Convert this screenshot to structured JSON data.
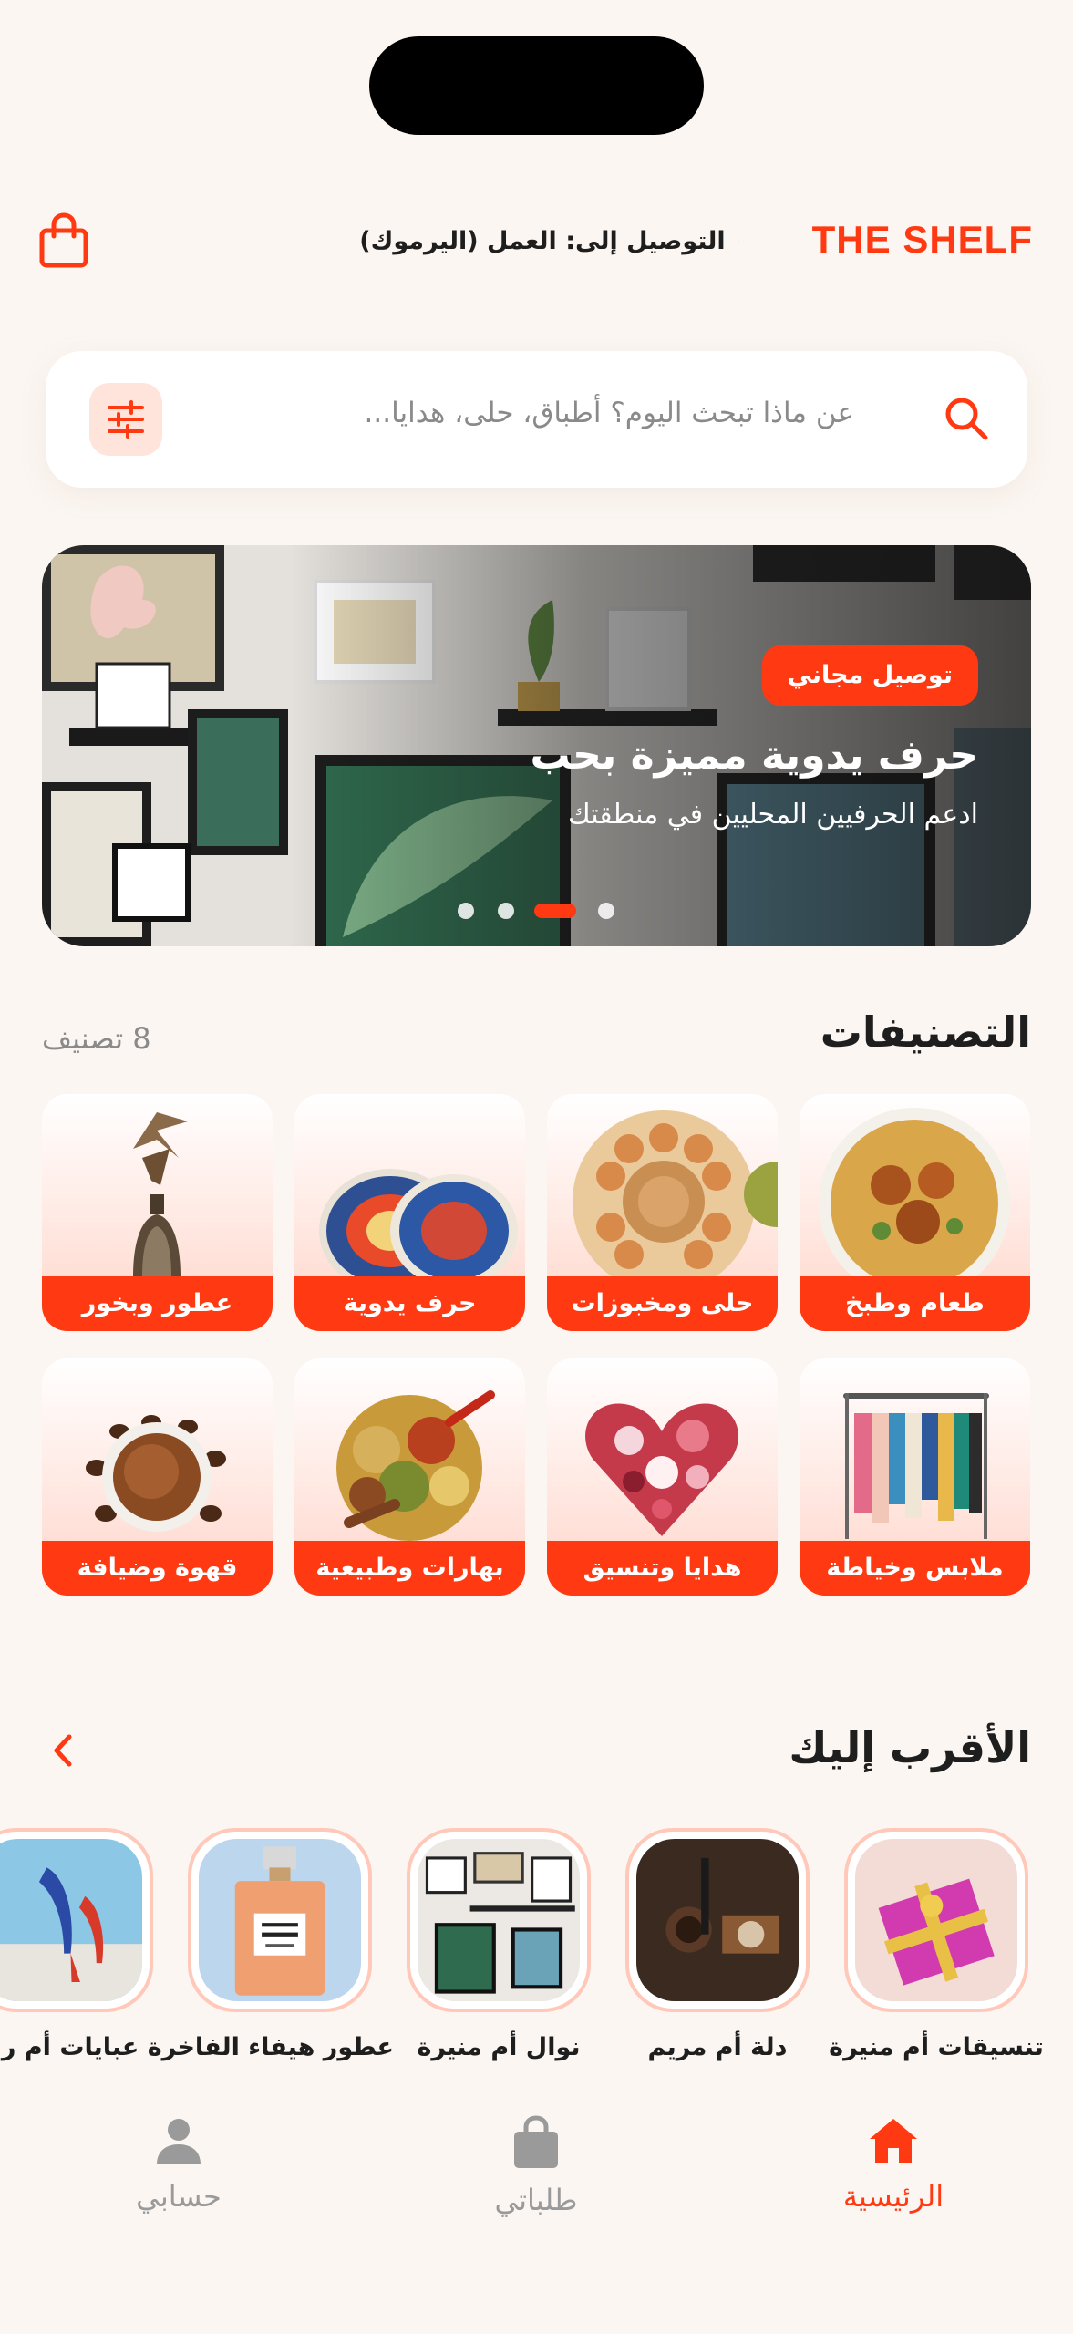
{
  "header": {
    "logo": "THE SHELF",
    "delivery_text": "التوصيل إلى: العمل (اليرموك)"
  },
  "search": {
    "placeholder": "عن ماذا تبحث اليوم؟ أطباق، حلى، هدايا..."
  },
  "banner": {
    "badge": "توصيل مجاني",
    "title": "حرف يدوية مميزة بحب",
    "subtitle": "ادعم الحرفيين المحليين في منطقتك",
    "active_slide": 2,
    "slide_count": 4
  },
  "categories": {
    "title": "التصنيفات",
    "count": "8 تصنيف",
    "items": [
      {
        "label": "طعام وطبخ",
        "icon": "food-icon"
      },
      {
        "label": "حلى ومخبوزات",
        "icon": "sweets-icon"
      },
      {
        "label": "حرف يدوية",
        "icon": "handcraft-icon"
      },
      {
        "label": "عطور وبخور",
        "icon": "perfume-icon"
      },
      {
        "label": "ملابس وخياطة",
        "icon": "clothes-icon"
      },
      {
        "label": "هدايا وتنسيق",
        "icon": "gift-flowers-icon"
      },
      {
        "label": "بهارات وطبيعية",
        "icon": "spices-icon"
      },
      {
        "label": "قهوة وضيافة",
        "icon": "coffee-icon"
      }
    ]
  },
  "nearest": {
    "title": "الأقرب إليك",
    "stores": [
      {
        "name": "تنسيقات أم منيرة"
      },
      {
        "name": "دلة أم مريم"
      },
      {
        "name": "نوال أم منيرة"
      },
      {
        "name": "عطور هيفاء الفاخرة"
      },
      {
        "name": "عبايات أم رنا"
      }
    ]
  },
  "nav": {
    "home": "الرئيسية",
    "orders": "طلباتي",
    "account": "حسابي"
  },
  "colors": {
    "accent": "#ff3a12",
    "background": "#fbf6f2",
    "text": "#1e1e1e",
    "muted": "#8a8a8a"
  }
}
